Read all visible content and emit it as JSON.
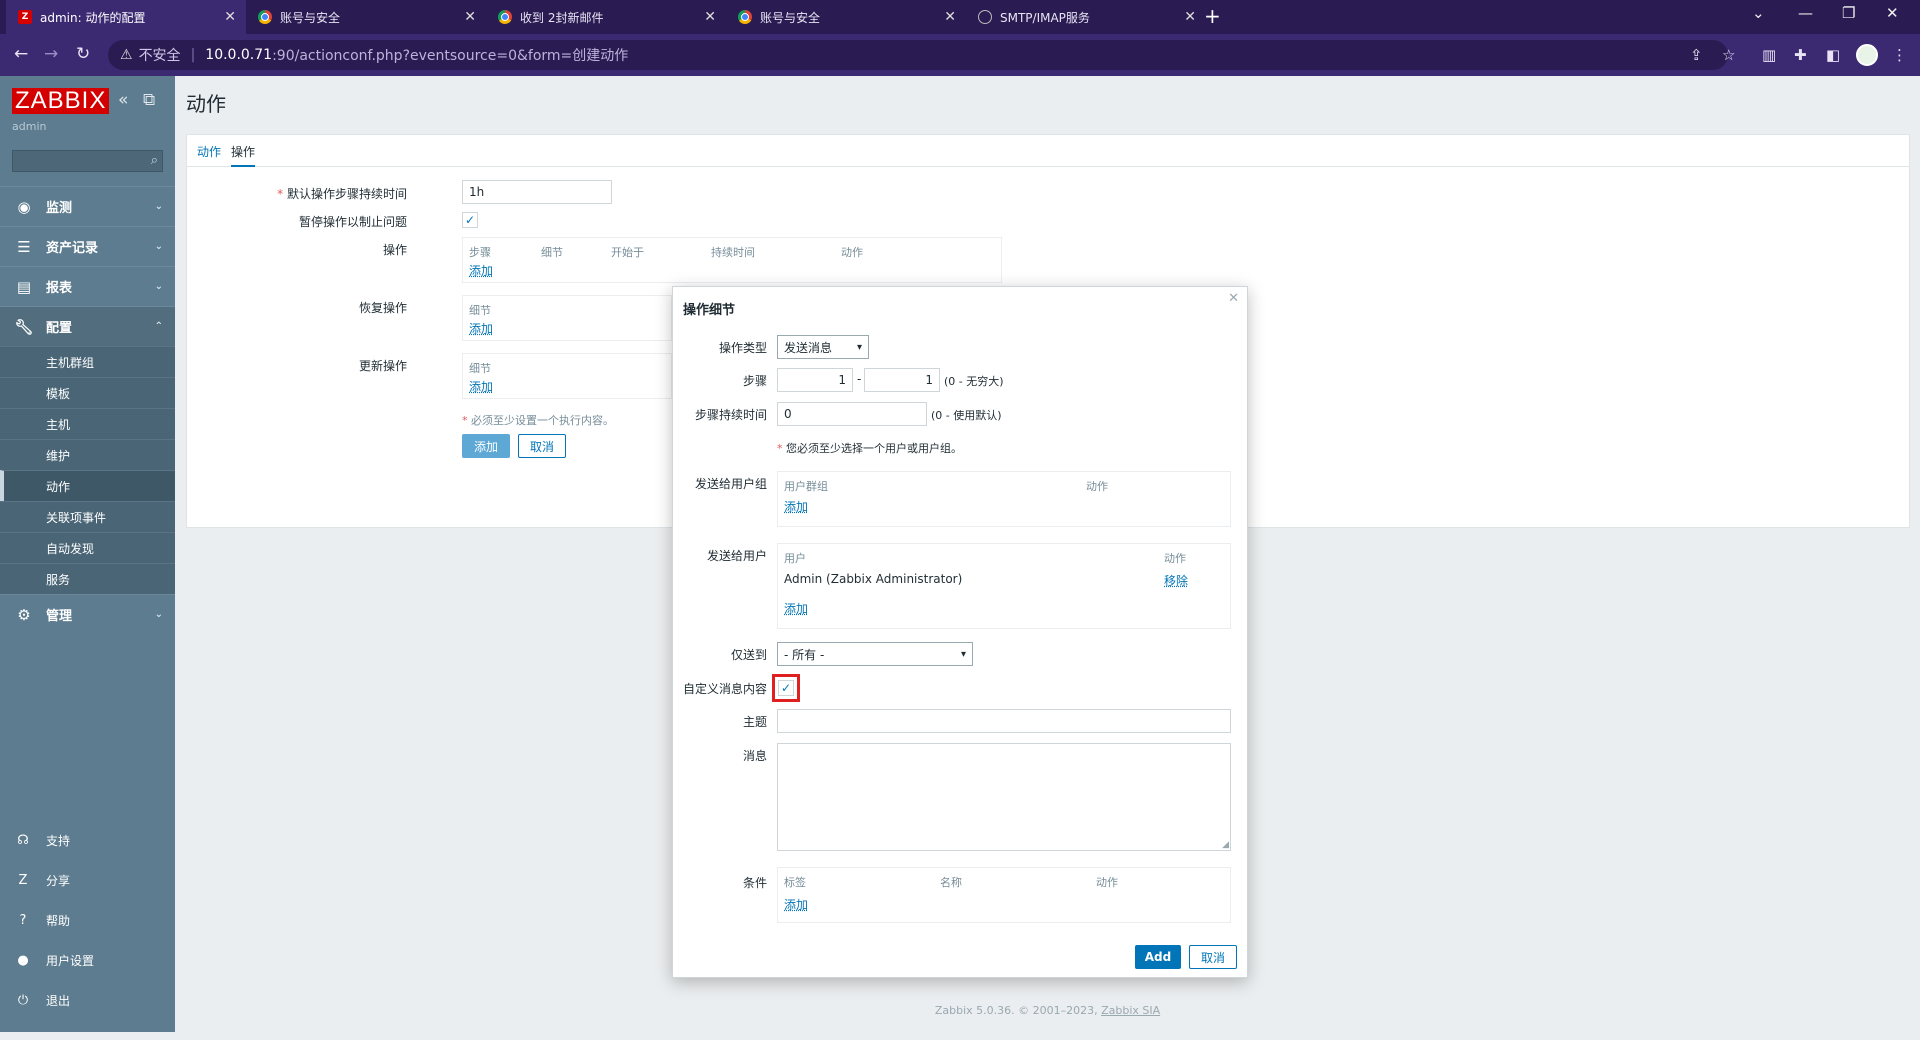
{
  "browser": {
    "tabs": [
      {
        "title": "admin: 动作的配置",
        "favicon": "zabbix"
      },
      {
        "title": "账号与安全",
        "favicon": "chrome"
      },
      {
        "title": "收到 2封新邮件",
        "favicon": "chrome"
      },
      {
        "title": "账号与安全",
        "favicon": "chrome"
      },
      {
        "title": "SMTP/IMAP服务",
        "favicon": "web"
      }
    ],
    "insecure_label": "不安全",
    "url_host": "10.0.0.71",
    "url_path": ":90/actionconf.php?eventsource=0&form=创建动作"
  },
  "sidebar": {
    "logo": "ZABBIX",
    "user": "admin",
    "menu": [
      {
        "label": "监测",
        "icon": "eye-icon"
      },
      {
        "label": "资产记录",
        "icon": "list-icon"
      },
      {
        "label": "报表",
        "icon": "chart-icon"
      },
      {
        "label": "配置",
        "icon": "wrench-icon"
      }
    ],
    "config_items": [
      "主机群组",
      "模板",
      "主机",
      "维护",
      "动作",
      "关联项事件",
      "自动发现",
      "服务"
    ],
    "admin": "管理",
    "bottom": [
      {
        "label": "支持",
        "icon": "headset-icon"
      },
      {
        "label": "分享",
        "icon": "share-icon"
      },
      {
        "label": "帮助",
        "icon": "help-icon"
      },
      {
        "label": "用户设置",
        "icon": "user-icon"
      },
      {
        "label": "退出",
        "icon": "power-icon"
      }
    ]
  },
  "page": {
    "title": "动作",
    "tabs": [
      "动作",
      "操作"
    ],
    "form": {
      "default_duration_label": "默认操作步骤持续时间",
      "default_duration_value": "1h",
      "pause_label": "暂停操作以制止问题",
      "operations_label": "操作",
      "operations_headers": [
        "步骤",
        "细节",
        "开始于",
        "持续时间",
        "动作"
      ],
      "recovery_label": "恢复操作",
      "update_label": "更新操作",
      "detail_header": "细节",
      "add_link": "添加",
      "required_note": "必须至少设置一个执行内容。",
      "add_button": "添加",
      "cancel_button": "取消"
    }
  },
  "modal": {
    "title": "操作细节",
    "op_type_label": "操作类型",
    "op_type_value": "发送消息",
    "steps_label": "步骤",
    "step_from": "1",
    "step_to": "1",
    "steps_hint": "(0 - 无穷大)",
    "step_duration_label": "步骤持续时间",
    "step_duration_value": "0",
    "step_duration_hint": "(0 - 使用默认)",
    "required_note": "您必须至少选择一个用户或用户组。",
    "send_groups_label": "发送给用户组",
    "groups_headers": [
      "用户群组",
      "动作"
    ],
    "send_users_label": "发送给用户",
    "users_headers": [
      "用户",
      "动作"
    ],
    "user_name": "Admin (Zabbix Administrator)",
    "remove_link": "移除",
    "add_link": "添加",
    "only_send_label": "仅送到",
    "only_send_value": "- 所有 -",
    "custom_msg_label": "自定义消息内容",
    "subject_label": "主题",
    "message_label": "消息",
    "conditions_label": "条件",
    "conditions_headers": [
      "标签",
      "名称",
      "动作"
    ],
    "add_button": "Add",
    "cancel_button": "取消"
  },
  "footer": {
    "text": "Zabbix 5.0.36. © 2001–2023, ",
    "company": "Zabbix SIA"
  }
}
